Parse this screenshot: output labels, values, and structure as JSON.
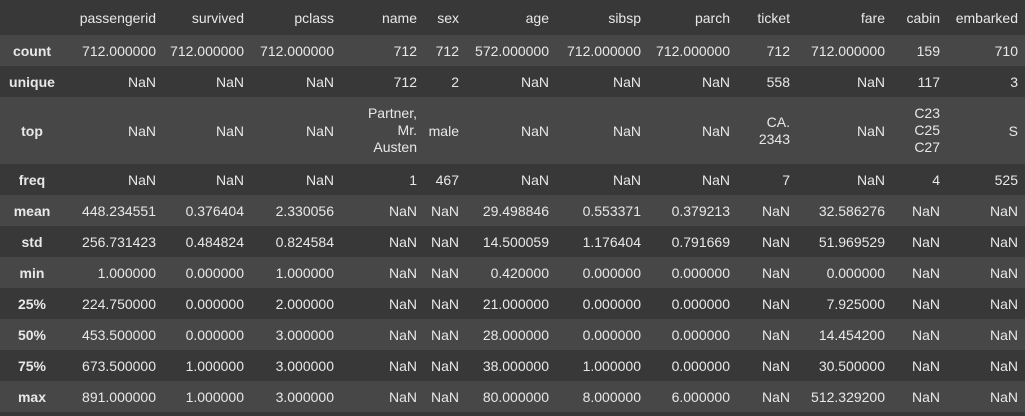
{
  "columns": [
    "passengerid",
    "survived",
    "pclass",
    "name",
    "sex",
    "age",
    "sibsp",
    "parch",
    "ticket",
    "fare",
    "cabin",
    "embarked"
  ],
  "rows": [
    {
      "label": "count",
      "cells": [
        "712.000000",
        "712.000000",
        "712.000000",
        "712",
        "712",
        "572.000000",
        "712.000000",
        "712.000000",
        "712",
        "712.000000",
        "159",
        "710"
      ]
    },
    {
      "label": "unique",
      "cells": [
        "NaN",
        "NaN",
        "NaN",
        "712",
        "2",
        "NaN",
        "NaN",
        "NaN",
        "558",
        "NaN",
        "117",
        "3"
      ]
    },
    {
      "label": "top",
      "cells": [
        "NaN",
        "NaN",
        "NaN",
        [
          "Partner,",
          "Mr.",
          "Austen"
        ],
        "male",
        "NaN",
        "NaN",
        "NaN",
        [
          "CA.",
          "2343"
        ],
        "NaN",
        [
          "C23",
          "C25",
          "C27"
        ],
        "S"
      ]
    },
    {
      "label": "freq",
      "cells": [
        "NaN",
        "NaN",
        "NaN",
        "1",
        "467",
        "NaN",
        "NaN",
        "NaN",
        "7",
        "NaN",
        "4",
        "525"
      ]
    },
    {
      "label": "mean",
      "cells": [
        "448.234551",
        "0.376404",
        "2.330056",
        "NaN",
        "NaN",
        "29.498846",
        "0.553371",
        "0.379213",
        "NaN",
        "32.586276",
        "NaN",
        "NaN"
      ]
    },
    {
      "label": "std",
      "cells": [
        "256.731423",
        "0.484824",
        "0.824584",
        "NaN",
        "NaN",
        "14.500059",
        "1.176404",
        "0.791669",
        "NaN",
        "51.969529",
        "NaN",
        "NaN"
      ]
    },
    {
      "label": "min",
      "cells": [
        "1.000000",
        "0.000000",
        "1.000000",
        "NaN",
        "NaN",
        "0.420000",
        "0.000000",
        "0.000000",
        "NaN",
        "0.000000",
        "NaN",
        "NaN"
      ]
    },
    {
      "label": "25%",
      "cells": [
        "224.750000",
        "0.000000",
        "2.000000",
        "NaN",
        "NaN",
        "21.000000",
        "0.000000",
        "0.000000",
        "NaN",
        "7.925000",
        "NaN",
        "NaN"
      ]
    },
    {
      "label": "50%",
      "cells": [
        "453.500000",
        "0.000000",
        "3.000000",
        "NaN",
        "NaN",
        "28.000000",
        "0.000000",
        "0.000000",
        "NaN",
        "14.454200",
        "NaN",
        "NaN"
      ]
    },
    {
      "label": "75%",
      "cells": [
        "673.500000",
        "1.000000",
        "3.000000",
        "NaN",
        "NaN",
        "38.000000",
        "1.000000",
        "0.000000",
        "NaN",
        "30.500000",
        "NaN",
        "NaN"
      ]
    },
    {
      "label": "max",
      "cells": [
        "891.000000",
        "1.000000",
        "3.000000",
        "NaN",
        "NaN",
        "80.000000",
        "8.000000",
        "6.000000",
        "NaN",
        "512.329200",
        "NaN",
        "NaN"
      ]
    }
  ],
  "colors": {
    "background": "#383838",
    "stripe": "#474747",
    "text": "#e8e8e8"
  }
}
